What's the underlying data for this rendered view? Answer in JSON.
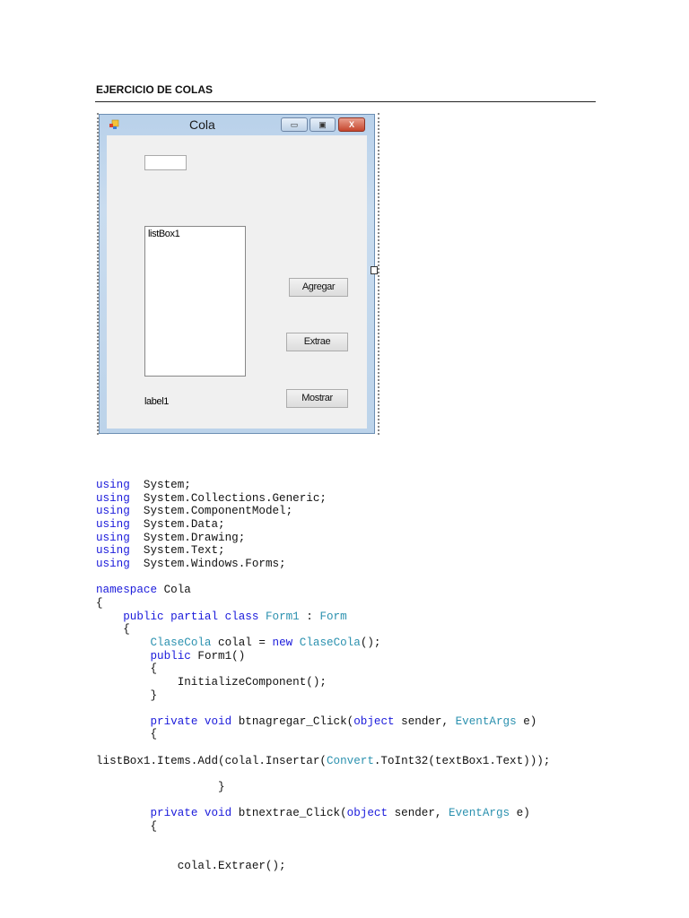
{
  "document": {
    "title": "EJERCICIO DE COLAS"
  },
  "form": {
    "title": "Cola",
    "minimize": "▭",
    "maximize": "▣",
    "close": "X",
    "textbox_value": "",
    "listbox_label": "listBox1",
    "label": "label1",
    "buttons": {
      "agregar": "Agregar",
      "extrae": "Extrae",
      "mostrar": "Mostrar"
    }
  },
  "colors": {
    "keyword": "#1a1adb",
    "type": "#2b91af"
  },
  "code": [
    [
      [
        "kw",
        "using"
      ],
      [
        "",
        "  System;"
      ]
    ],
    [
      [
        "kw",
        "using"
      ],
      [
        "",
        "  System.Collections.Generic;"
      ]
    ],
    [
      [
        "kw",
        "using"
      ],
      [
        "",
        "  System.ComponentModel;"
      ]
    ],
    [
      [
        "kw",
        "using"
      ],
      [
        "",
        "  System.Data;"
      ]
    ],
    [
      [
        "kw",
        "using"
      ],
      [
        "",
        "  System.Drawing;"
      ]
    ],
    [
      [
        "kw",
        "using"
      ],
      [
        "",
        "  System.Text;"
      ]
    ],
    [
      [
        "kw",
        "using"
      ],
      [
        "",
        "  System.Windows.Forms;"
      ]
    ],
    [],
    [
      [
        "kw",
        "namespace"
      ],
      [
        "",
        " Cola"
      ]
    ],
    [
      [
        "",
        "{"
      ]
    ],
    [
      [
        "",
        "    "
      ],
      [
        "kw",
        "public partial class"
      ],
      [
        "",
        " "
      ],
      [
        "ty",
        "Form1"
      ],
      [
        "",
        " : "
      ],
      [
        "ty",
        "Form"
      ]
    ],
    [
      [
        "",
        "    {"
      ]
    ],
    [
      [
        "",
        "        "
      ],
      [
        "ty",
        "ClaseCola"
      ],
      [
        "",
        " colal = "
      ],
      [
        "kw",
        "new"
      ],
      [
        "",
        " "
      ],
      [
        "ty",
        "ClaseCola"
      ],
      [
        "",
        "();"
      ]
    ],
    [
      [
        "",
        "        "
      ],
      [
        "kw",
        "public"
      ],
      [
        "",
        " Form1()"
      ]
    ],
    [
      [
        "",
        "        {"
      ]
    ],
    [
      [
        "",
        "            InitializeComponent();"
      ]
    ],
    [
      [
        "",
        "        }"
      ]
    ],
    [],
    [
      [
        "",
        "        "
      ],
      [
        "kw",
        "private void"
      ],
      [
        "",
        " btnagregar_Click("
      ],
      [
        "kw",
        "object"
      ],
      [
        "",
        " sender, "
      ],
      [
        "ty",
        "EventArgs"
      ],
      [
        "",
        " e)"
      ]
    ],
    [
      [
        "",
        "        {"
      ]
    ],
    [],
    [
      [
        "",
        "listBox1.Items.Add(colal.Insertar("
      ],
      [
        "ty",
        "Convert"
      ],
      [
        "",
        ".ToInt32(textBox1.Text)));"
      ]
    ],
    [],
    [
      [
        "",
        "                  }"
      ]
    ],
    [],
    [
      [
        "",
        "        "
      ],
      [
        "kw",
        "private void"
      ],
      [
        "",
        " btnextrae_Click("
      ],
      [
        "kw",
        "object"
      ],
      [
        "",
        " sender, "
      ],
      [
        "ty",
        "EventArgs"
      ],
      [
        "",
        " e)"
      ]
    ],
    [
      [
        "",
        "        {"
      ]
    ],
    [],
    [],
    [
      [
        "",
        "            colal.Extraer();"
      ]
    ]
  ]
}
